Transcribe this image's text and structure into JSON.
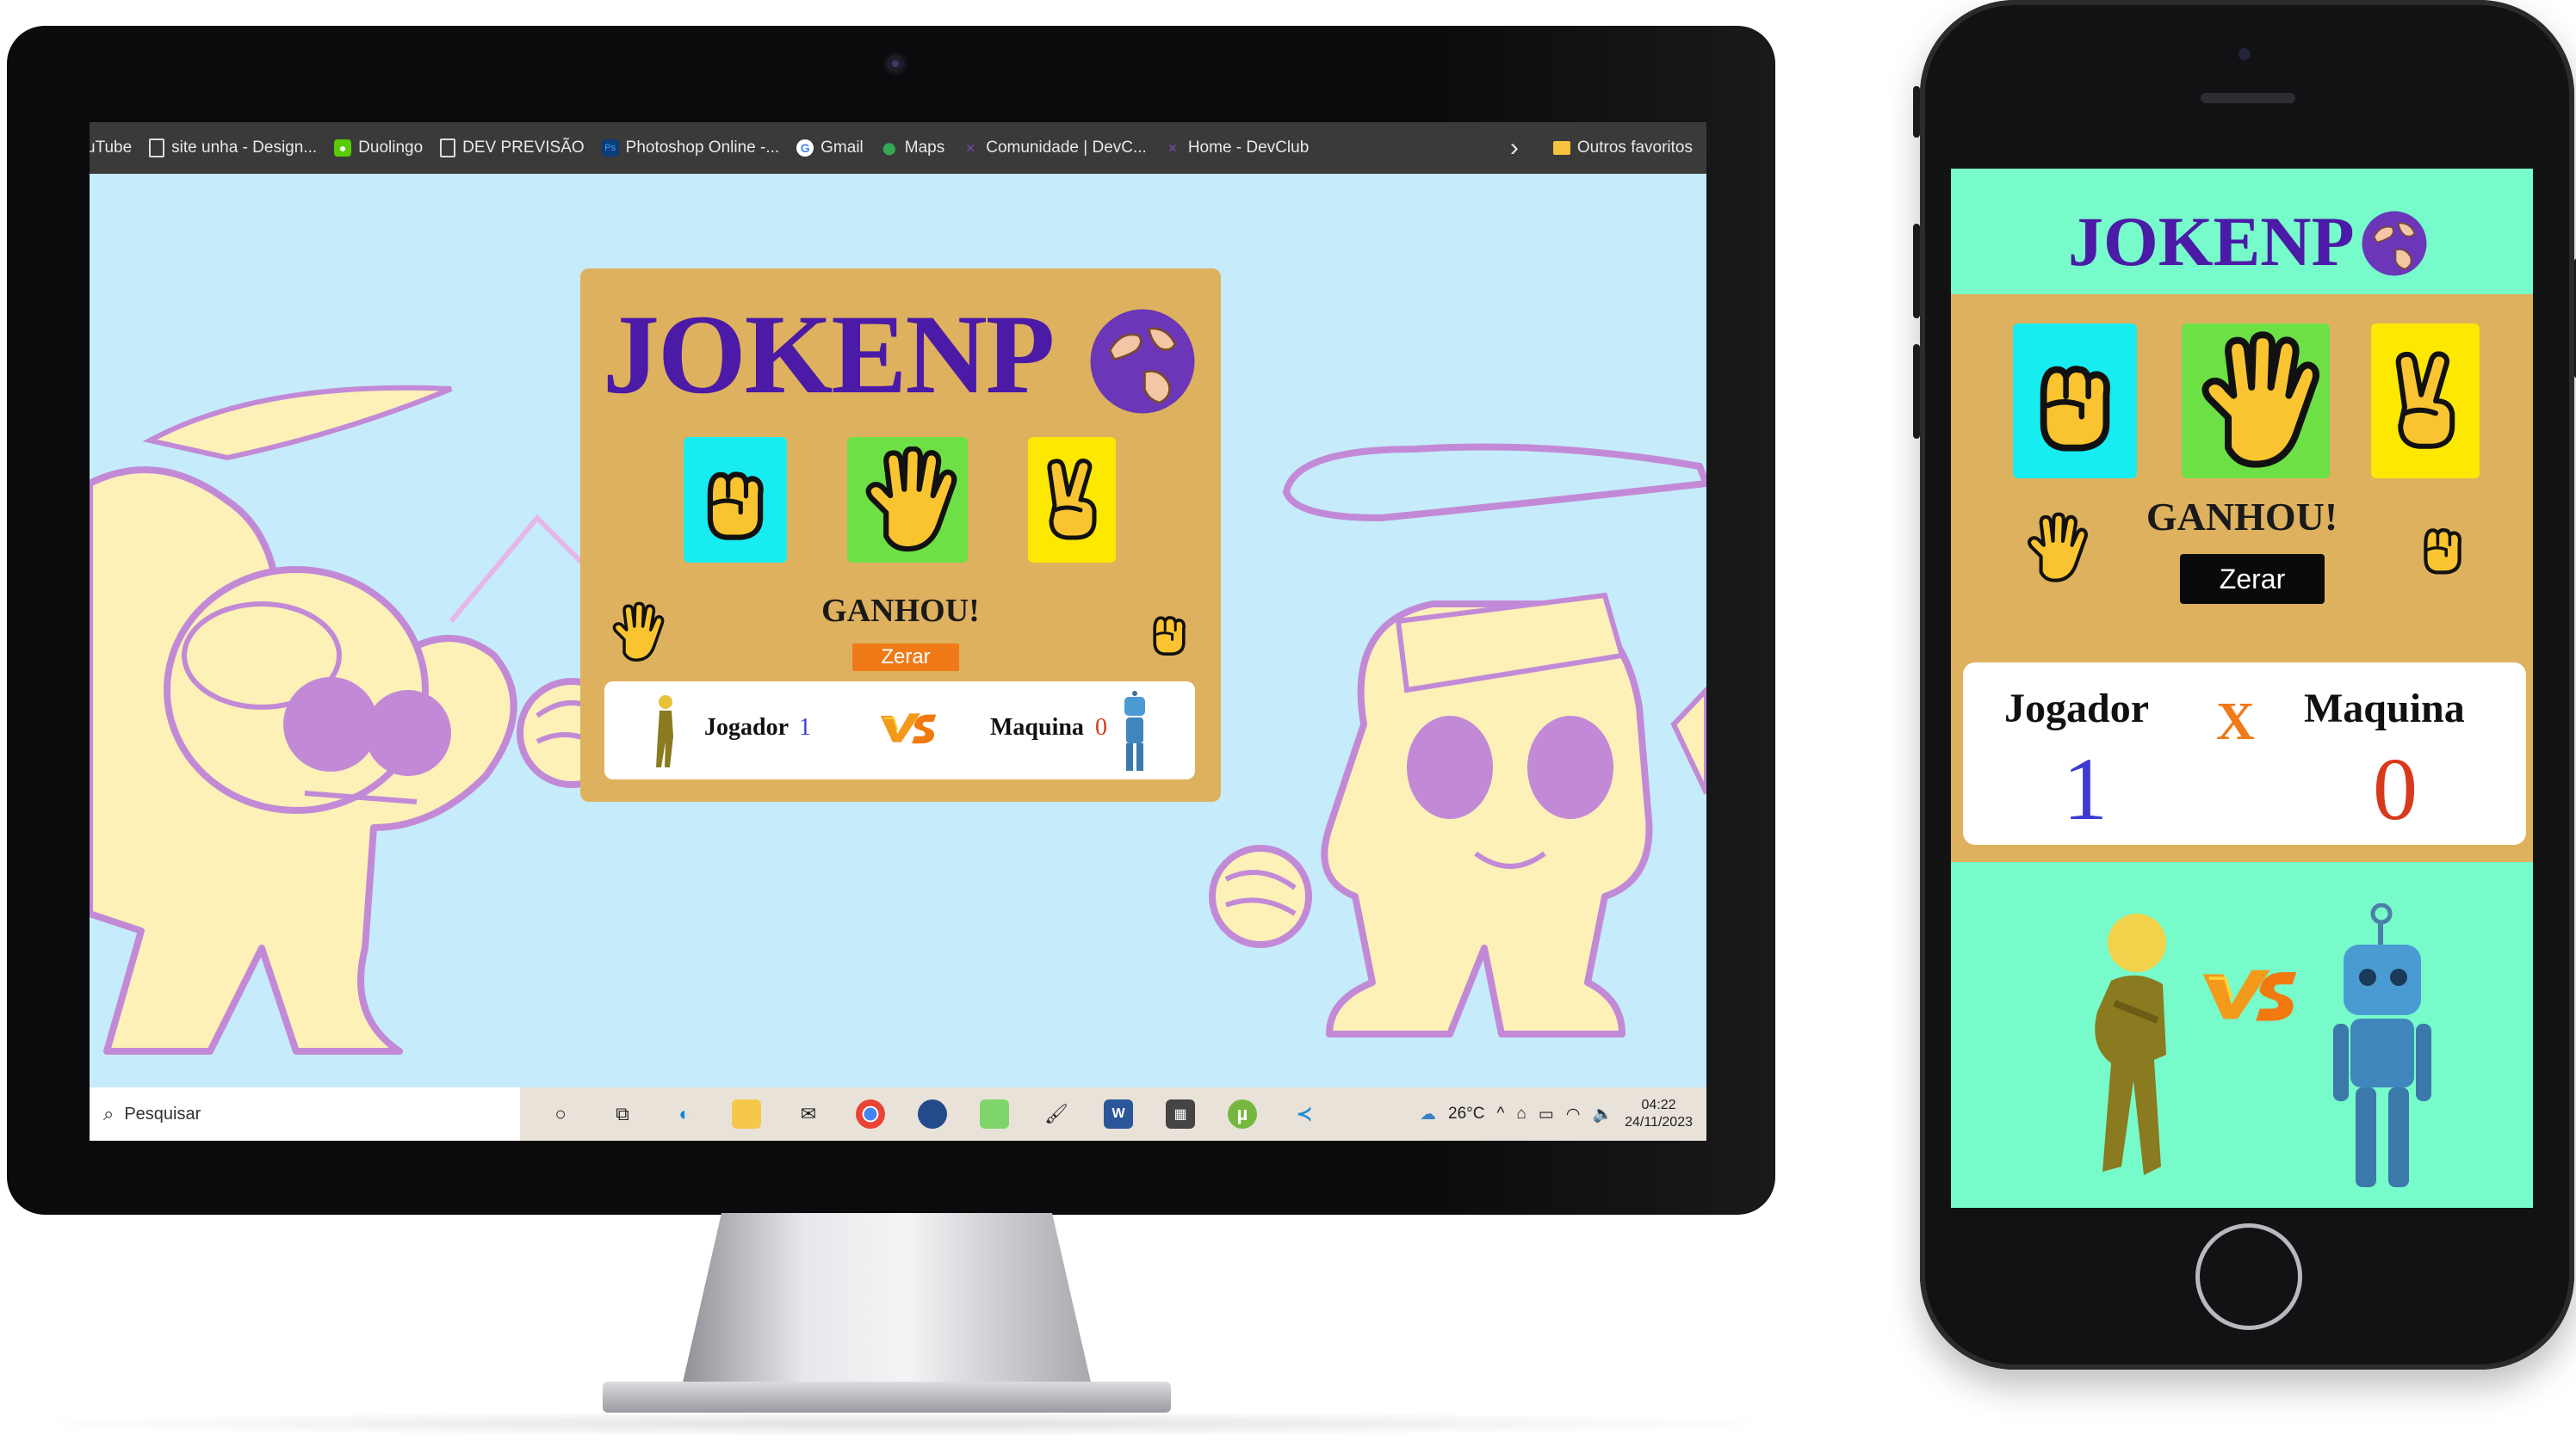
{
  "browser": {
    "bookmarks": [
      {
        "label": "uTube",
        "icon": "youtube-icon"
      },
      {
        "label": "site unha - Design...",
        "icon": "page-icon"
      },
      {
        "label": "Duolingo",
        "icon": "duolingo-icon"
      },
      {
        "label": "DEV PREVISÃO",
        "icon": "page-icon"
      },
      {
        "label": "Photoshop Online -...",
        "icon": "photoshop-icon"
      },
      {
        "label": "Gmail",
        "icon": "google-icon"
      },
      {
        "label": "Maps",
        "icon": "maps-icon"
      },
      {
        "label": "Comunidade | DevC...",
        "icon": "devclub-icon"
      },
      {
        "label": "Home - DevClub",
        "icon": "devclub-icon"
      }
    ],
    "more": "›",
    "other_favorites": "Outros favoritos"
  },
  "desktop_game": {
    "title": "JOKENP",
    "choices": [
      "rock",
      "paper",
      "scissors"
    ],
    "result": "GANHOU!",
    "reset_label": "Zerar",
    "player_label": "Jogador",
    "player_score": "1",
    "vs_label": "VS",
    "machine_label": "Maquina",
    "machine_score": "0"
  },
  "taskbar": {
    "search_placeholder": "Pesquisar",
    "temperature": "26°C",
    "time": "04:22",
    "date": "24/11/2023"
  },
  "mobile_game": {
    "title": "JOKENP",
    "result": "GANHOU!",
    "reset_label": "Zerar",
    "player_label": "Jogador",
    "vs_label": "X",
    "machine_label": "Maquina",
    "player_score": "1",
    "machine_score": "0",
    "vs_art": "VS"
  },
  "colors": {
    "title_purple": "#4b1aa6",
    "card_tan": "#deb15e",
    "rock_bg": "#17ecf0",
    "paper_bg": "#6ce045",
    "scissors_bg": "#fce800",
    "hand_yellow": "#f9c42f",
    "zerar_orange": "#ef7a17",
    "mobile_bg": "#77fbca",
    "player_score_color": "#3d3bd0",
    "machine_score_color": "#d8391b"
  }
}
